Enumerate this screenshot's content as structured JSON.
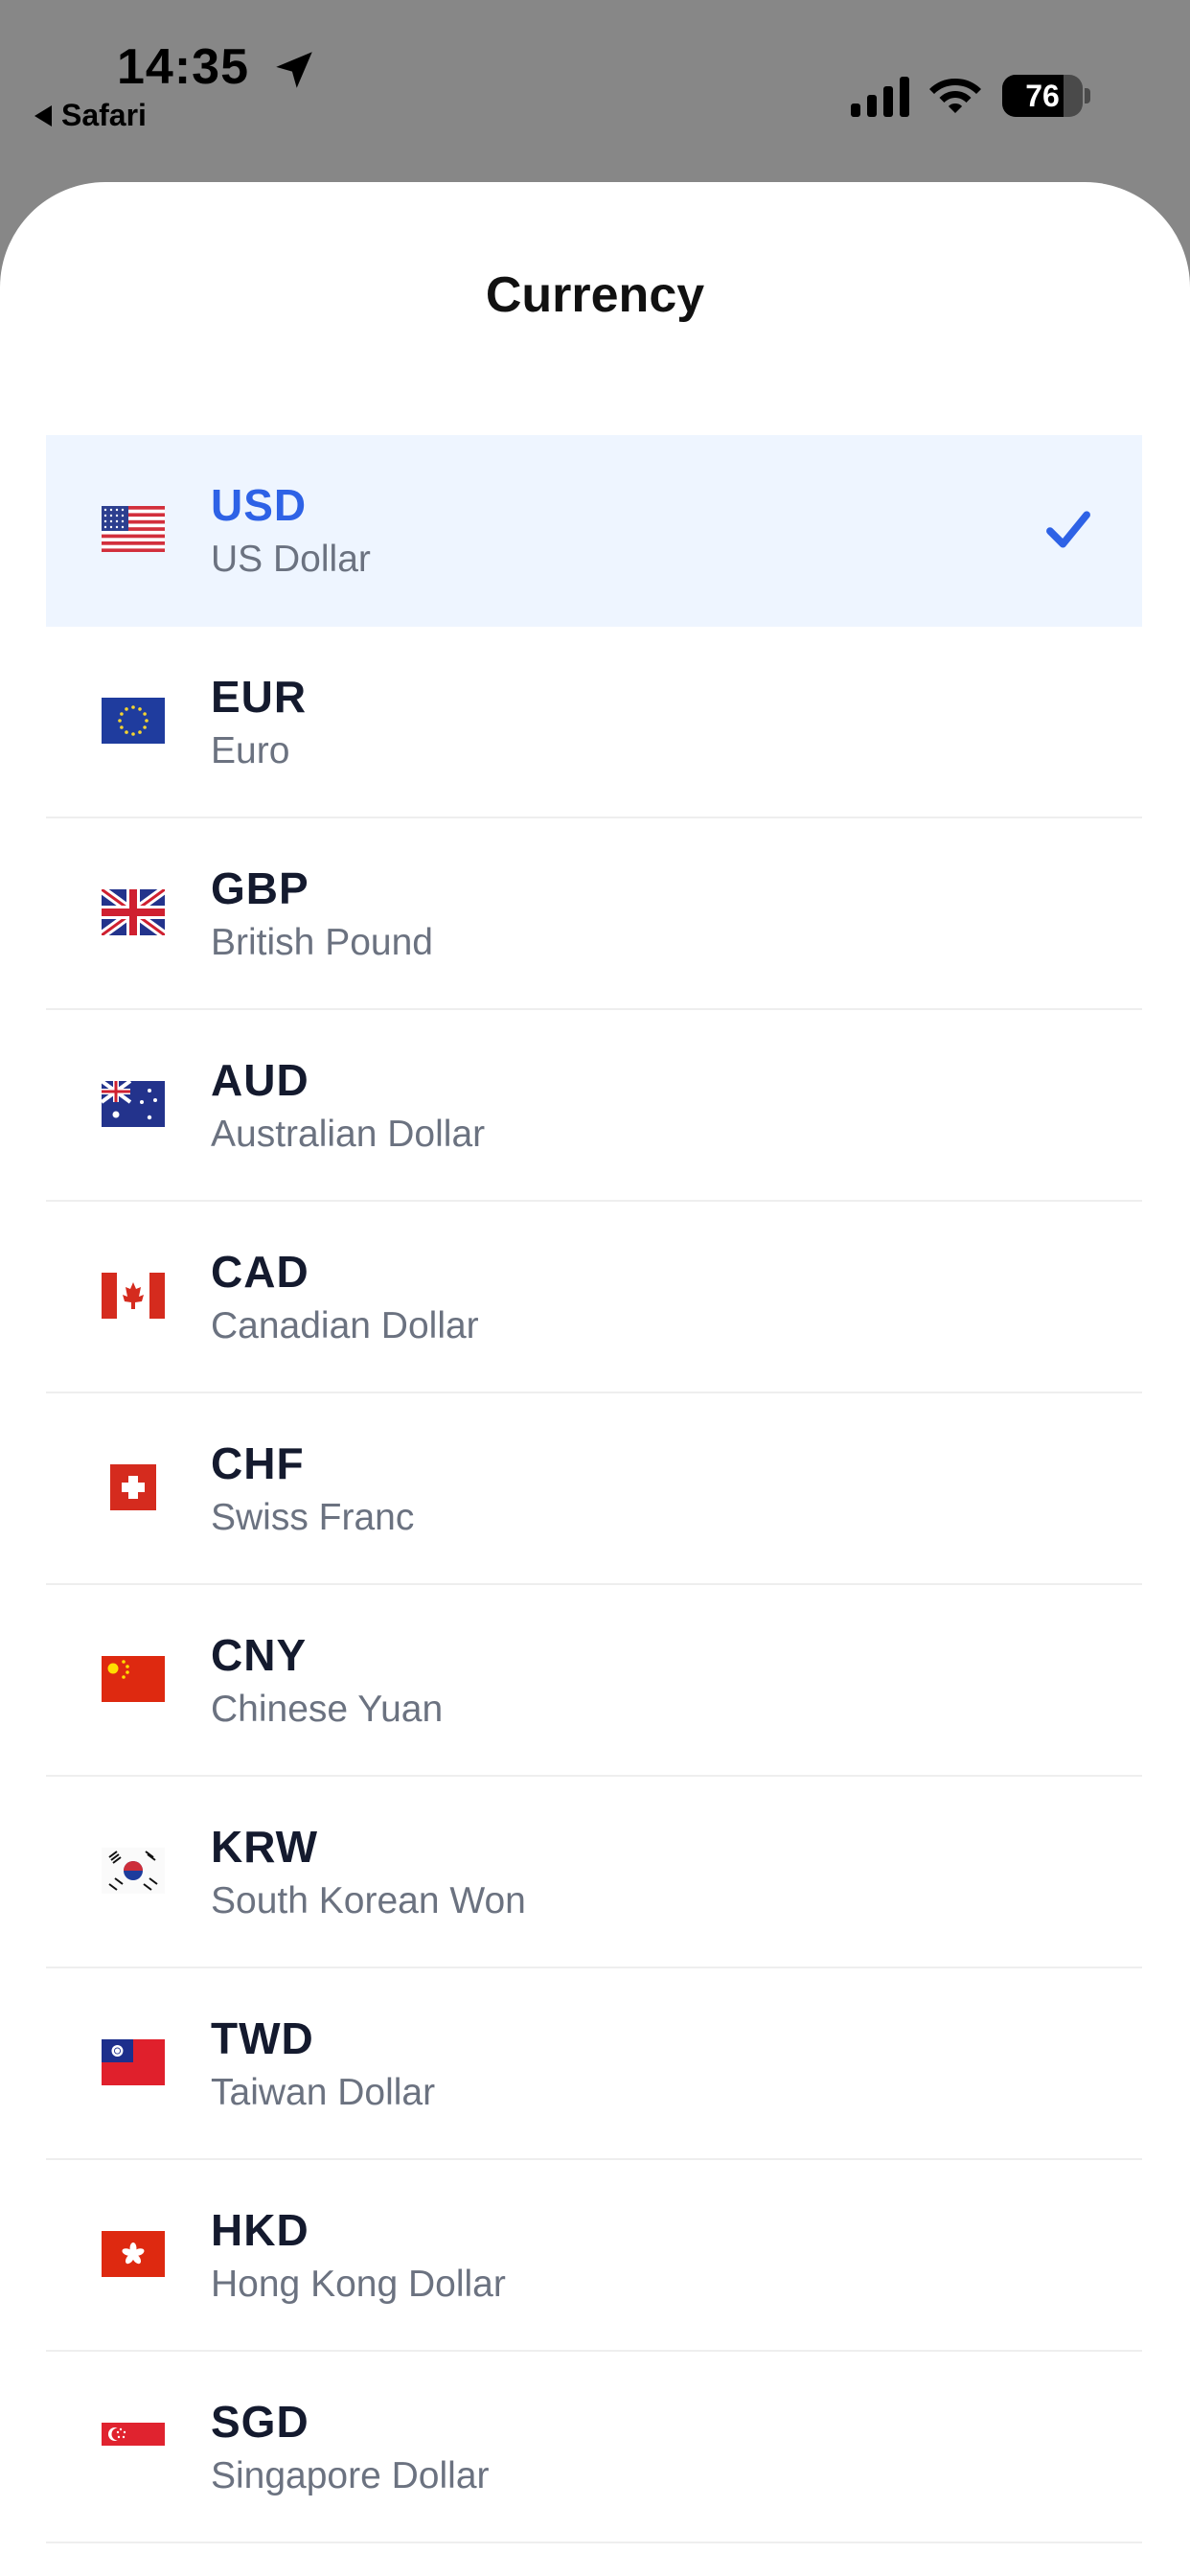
{
  "status_bar": {
    "time": "14:35",
    "back_app": "Safari",
    "battery_level": "76",
    "icons": [
      "location-arrow-icon",
      "cellular-signal-icon",
      "wifi-icon",
      "battery-icon"
    ]
  },
  "sheet": {
    "title": "Currency"
  },
  "currencies": [
    {
      "code": "USD",
      "name": "US Dollar",
      "flag": "us-flag-icon",
      "selected": true
    },
    {
      "code": "EUR",
      "name": "Euro",
      "flag": "eu-flag-icon",
      "selected": false
    },
    {
      "code": "GBP",
      "name": "British Pound",
      "flag": "gb-flag-icon",
      "selected": false
    },
    {
      "code": "AUD",
      "name": "Australian Dollar",
      "flag": "au-flag-icon",
      "selected": false
    },
    {
      "code": "CAD",
      "name": "Canadian Dollar",
      "flag": "ca-flag-icon",
      "selected": false
    },
    {
      "code": "CHF",
      "name": "Swiss Franc",
      "flag": "ch-flag-icon",
      "selected": false
    },
    {
      "code": "CNY",
      "name": "Chinese Yuan",
      "flag": "cn-flag-icon",
      "selected": false
    },
    {
      "code": "KRW",
      "name": "South Korean Won",
      "flag": "kr-flag-icon",
      "selected": false
    },
    {
      "code": "TWD",
      "name": "Taiwan Dollar",
      "flag": "tw-flag-icon",
      "selected": false
    },
    {
      "code": "HKD",
      "name": "Hong Kong Dollar",
      "flag": "hk-flag-icon",
      "selected": false
    },
    {
      "code": "SGD",
      "name": "Singapore Dollar",
      "flag": "sg-flag-icon",
      "selected": false
    }
  ],
  "colors": {
    "accent": "#2e62e6",
    "selected_row_bg": "#eef5ff",
    "backdrop": "#878787"
  }
}
